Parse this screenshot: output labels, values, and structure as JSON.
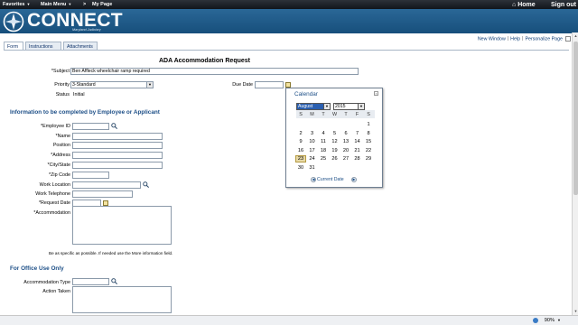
{
  "topbar": {
    "favorites": "Favorites",
    "main_menu": "Main Menu",
    "breadcrumb": "My Page",
    "home": "Home",
    "sign_out": "Sign out",
    "bg_color": "#1a1f25"
  },
  "banner": {
    "logo_text": "CONNECT",
    "logo_sub": "Maryland Judiciary",
    "bg_color": "#205c8c"
  },
  "page_links": {
    "new_window": "New Window",
    "help": "Help",
    "personalize": "Personalize Page"
  },
  "tabs": [
    {
      "label": "Form",
      "active": true
    },
    {
      "label": "Instructions",
      "active": false
    },
    {
      "label": "Attachments",
      "active": false
    }
  ],
  "form": {
    "title": "ADA Accommodation Request",
    "subject_label": "*Subject",
    "subject_value": "Ben Affleck wheelchair ramp required",
    "priority_label": "Priority",
    "priority_value": "3-Standard",
    "due_date_label": "Due Date",
    "status_label": "Status",
    "status_value": "Initial",
    "section_employee": "Information to be completed by Employee or Applicant",
    "employee_id_label": "*Employee ID",
    "name_label": "*Name",
    "position_label": "Position",
    "address_label": "*Address",
    "city_state_label": "*City/State",
    "zip_label": "*Zip Code",
    "work_location_label": "Work Location",
    "work_telephone_label": "Work Telephone",
    "request_date_label": "*Request Date",
    "accommodation_label": "*Accommodation",
    "accommodation_note": "Be as specific as possible. If needed use the More information field.",
    "section_office": "For Office Use Only",
    "accommodation_type_label": "Accommodation Type",
    "action_taken_label": "Action Taken"
  },
  "calendar": {
    "title": "Calendar",
    "month": "August",
    "year": "2015",
    "days_of_week": [
      "S",
      "M",
      "T",
      "W",
      "T",
      "F",
      "S"
    ],
    "weeks": [
      [
        "",
        "",
        "",
        "",
        "",
        "",
        "1"
      ],
      [
        "2",
        "3",
        "4",
        "5",
        "6",
        "7",
        "8"
      ],
      [
        "9",
        "10",
        "11",
        "12",
        "13",
        "14",
        "15"
      ],
      [
        "16",
        "17",
        "18",
        "19",
        "20",
        "21",
        "22"
      ],
      [
        "23",
        "24",
        "25",
        "26",
        "27",
        "28",
        "29"
      ],
      [
        "30",
        "31",
        "",
        "",
        "",
        "",
        ""
      ]
    ],
    "today": "23",
    "current_date_label": "Current Date"
  },
  "status_bar": {
    "zoom": "90%"
  }
}
